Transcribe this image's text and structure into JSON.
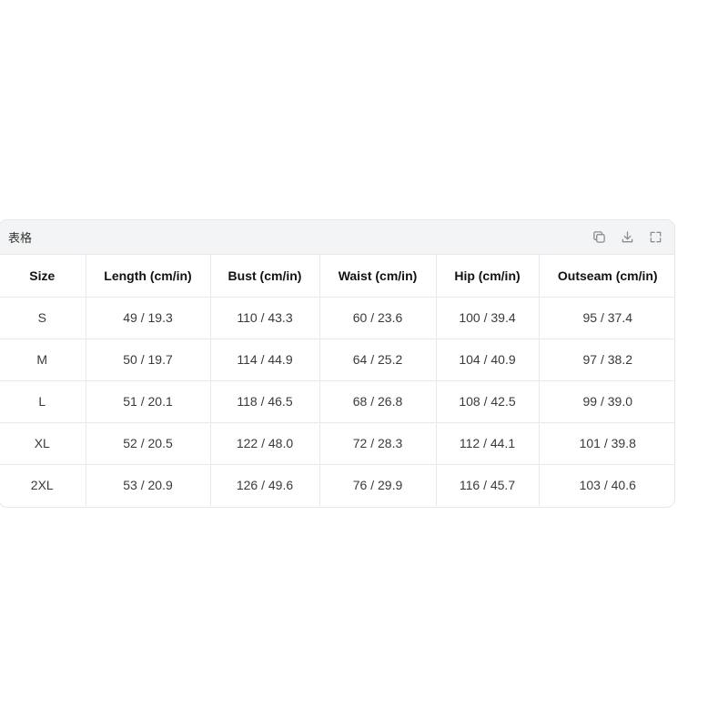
{
  "card": {
    "title": "表格",
    "tools": [
      {
        "name": "copy-icon"
      },
      {
        "name": "download-icon"
      },
      {
        "name": "expand-icon"
      }
    ]
  },
  "table": {
    "headers": [
      "Size",
      "Length (cm/in)",
      "Bust (cm/in)",
      "Waist (cm/in)",
      "Hip (cm/in)",
      "Outseam (cm/in)"
    ],
    "rows": [
      [
        "S",
        "49 / 19.3",
        "110 / 43.3",
        "60 / 23.6",
        "100 / 39.4",
        "95 / 37.4"
      ],
      [
        "M",
        "50 / 19.7",
        "114 / 44.9",
        "64 / 25.2",
        "104 / 40.9",
        "97 / 38.2"
      ],
      [
        "L",
        "51 / 20.1",
        "118 / 46.5",
        "68 / 26.8",
        "108 / 42.5",
        "99 / 39.0"
      ],
      [
        "XL",
        "52 / 20.5",
        "122 / 48.0",
        "72 / 28.3",
        "112 / 44.1",
        "101 / 39.8"
      ],
      [
        "2XL",
        "53 / 20.9",
        "126 / 49.6",
        "76 / 29.9",
        "116 / 45.7",
        "103 / 40.6"
      ]
    ]
  }
}
